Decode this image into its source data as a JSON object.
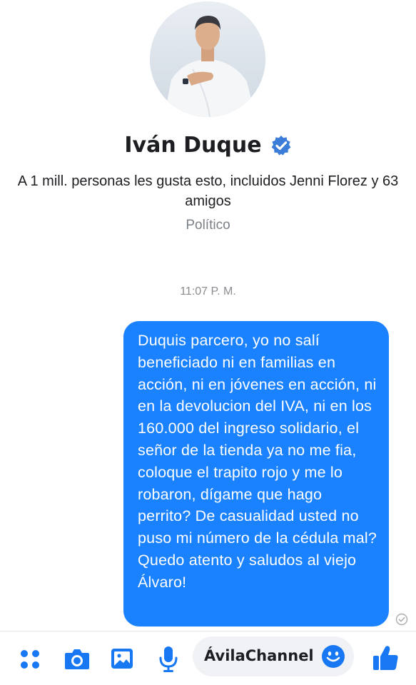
{
  "profile": {
    "name": "Iván Duque",
    "likes_text": "A 1 mill. personas les gusta esto, incluidos Jenni Florez y 63 amigos",
    "category": "Político"
  },
  "conversation": {
    "timestamp": "11:07 P. M.",
    "message": "Duquis parcero, yo no salí beneficiado ni en familias en acción, ni en jóvenes en acción, ni en la devolucion del IVA, ni en los 160.000 del ingreso solidario, el señor de la tienda ya no me fia, coloque el trapito rojo y me lo robaron, dígame que hago perrito? De casualidad usted no puso mi número de la cédula mal? Quedo atento y saludos al viejo Álvaro!"
  },
  "composer": {
    "text": "ÁvilaChannel"
  },
  "icons": [
    "verified-badge-icon",
    "seen-check-icon",
    "apps-grid-icon",
    "camera-icon",
    "gallery-icon",
    "microphone-icon",
    "emoji-icon",
    "thumbs-up-icon"
  ],
  "colors": {
    "accent": "#1b82ff",
    "text_primary": "#1c1e21",
    "text_secondary": "#7a7f86"
  }
}
